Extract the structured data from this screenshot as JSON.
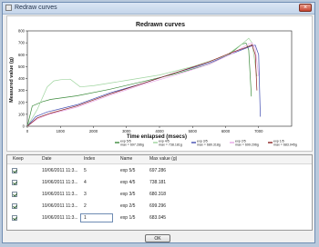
{
  "window": {
    "title": "Redraw curves",
    "close_glyph": "×"
  },
  "chart_data": {
    "type": "line",
    "title": "Redrawn curves",
    "xlabel": "Time enlapsed (msecs)",
    "ylabel": "Measured value (g)",
    "xlim": [
      0,
      8000
    ],
    "ylim": [
      0,
      800
    ],
    "xticks": [
      "0",
      "1000",
      "2000",
      "3000",
      "4000",
      "5000",
      "6000",
      "7000"
    ],
    "yticks": [
      "0",
      "100",
      "200",
      "300",
      "400",
      "500",
      "600",
      "700",
      "800"
    ],
    "grid": false,
    "legend_position": "bottom",
    "series": [
      {
        "name": "exp 5/5",
        "stat": "max = 697.286g",
        "color": "#3a8a3a",
        "points": [
          [
            0,
            0
          ],
          [
            150,
            170
          ],
          [
            450,
            205
          ],
          [
            700,
            225
          ],
          [
            1500,
            255
          ],
          [
            2500,
            310
          ],
          [
            3500,
            375
          ],
          [
            4500,
            440
          ],
          [
            5500,
            520
          ],
          [
            6100,
            600
          ],
          [
            6500,
            690
          ],
          [
            6620,
            697
          ],
          [
            6700,
            640
          ],
          [
            6780,
            250
          ]
        ]
      },
      {
        "name": "exp 4/5",
        "stat": "max = 738.181g",
        "color": "#9ed49e",
        "points": [
          [
            0,
            0
          ],
          [
            300,
            140
          ],
          [
            600,
            330
          ],
          [
            800,
            380
          ],
          [
            1000,
            390
          ],
          [
            1300,
            395
          ],
          [
            1600,
            330
          ],
          [
            2000,
            340
          ],
          [
            3000,
            385
          ],
          [
            4000,
            430
          ],
          [
            5000,
            500
          ],
          [
            6000,
            590
          ],
          [
            6500,
            690
          ],
          [
            6700,
            738
          ],
          [
            6800,
            700
          ],
          [
            6950,
            420
          ]
        ]
      },
      {
        "name": "exp 3/5",
        "stat": "max = 680.318g",
        "color": "#3f4bb0",
        "points": [
          [
            0,
            0
          ],
          [
            250,
            80
          ],
          [
            600,
            120
          ],
          [
            1500,
            180
          ],
          [
            2500,
            280
          ],
          [
            3500,
            360
          ],
          [
            4500,
            450
          ],
          [
            5500,
            530
          ],
          [
            6300,
            620
          ],
          [
            6800,
            675
          ],
          [
            6900,
            680
          ],
          [
            7000,
            600
          ],
          [
            7050,
            80
          ]
        ]
      },
      {
        "name": "exp 2/5",
        "stat": "max = 699.296g",
        "color": "#e8a8e8",
        "points": [
          [
            0,
            0
          ],
          [
            300,
            60
          ],
          [
            600,
            95
          ],
          [
            1500,
            160
          ],
          [
            2500,
            260
          ],
          [
            3500,
            350
          ],
          [
            4500,
            430
          ],
          [
            5500,
            520
          ],
          [
            6200,
            610
          ],
          [
            6700,
            690
          ],
          [
            6800,
            699
          ],
          [
            6900,
            650
          ],
          [
            7000,
            420
          ]
        ]
      },
      {
        "name": "exp 1/5",
        "stat": "max = 683.045g",
        "color": "#8a1f1f",
        "points": [
          [
            0,
            0
          ],
          [
            300,
            70
          ],
          [
            700,
            110
          ],
          [
            1500,
            170
          ],
          [
            2500,
            270
          ],
          [
            3500,
            360
          ],
          [
            4500,
            450
          ],
          [
            5500,
            540
          ],
          [
            6200,
            620
          ],
          [
            6600,
            660
          ],
          [
            6800,
            683
          ],
          [
            6900,
            600
          ],
          [
            6950,
            300
          ]
        ]
      }
    ]
  },
  "table": {
    "headers": [
      "Keep",
      "Date",
      "Index",
      "Name",
      "Max value (g)"
    ],
    "rows": [
      {
        "date": "10/06/2011 11:3...",
        "index": "5",
        "name": "exp 5/5",
        "max": "697.286"
      },
      {
        "date": "10/06/2011 11:3...",
        "index": "4",
        "name": "exp 4/5",
        "max": "738.181"
      },
      {
        "date": "10/06/2011 11:3...",
        "index": "3",
        "name": "exp 3/5",
        "max": "680.318"
      },
      {
        "date": "10/06/2011 11:3...",
        "index": "2",
        "name": "exp 2/5",
        "max": "699.296"
      },
      {
        "date": "10/06/2011 11:3...",
        "index": "1",
        "name": "exp 1/5",
        "max": "683.045"
      }
    ]
  },
  "ok_label": "OK"
}
